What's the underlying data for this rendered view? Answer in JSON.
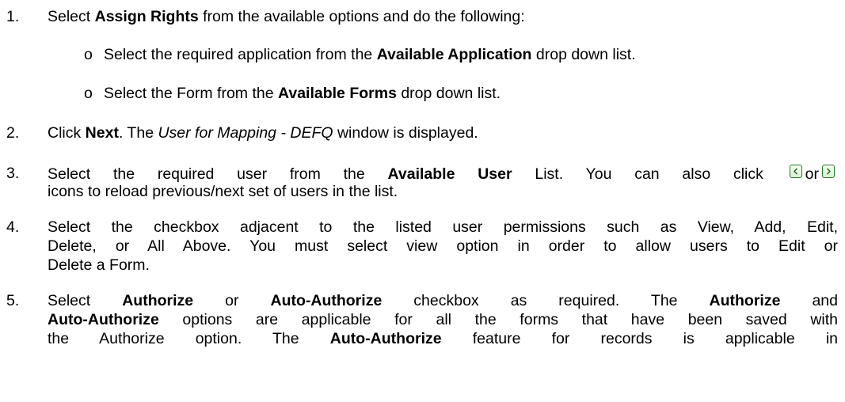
{
  "steps": [
    {
      "number": "1.",
      "pre": "Select ",
      "bold": "Assign Rights",
      "post": " from the available options and do the following:",
      "substeps": [
        {
          "bullet": "o",
          "pre": "Select the required application from the ",
          "bold": "Available Application",
          "post": " drop down list."
        },
        {
          "bullet": "o",
          "pre": "Select the Form from the ",
          "bold": "Available Forms",
          "post": " drop down list."
        }
      ]
    },
    {
      "number": "2.",
      "t1": "Click ",
      "b1": "Next",
      "t2": ". The ",
      "i1": "User for Mapping - DEFQ",
      "t3": " window is displayed."
    },
    {
      "number": "3.",
      "t1": "Select the required user from the ",
      "b1": "Available User",
      "t2": " List. You can also click",
      "t3": "or",
      "line2": "icons to reload previous/next set of users in the list.",
      "icon_prev": "previous-page-icon",
      "icon_next": "next-page-icon"
    },
    {
      "number": "4.",
      "line1": "Select the checkbox adjacent to the listed user permissions such as View, Add, Edit,",
      "line2": "Delete, or All Above. You must select view option in order to allow users to Edit or",
      "line3": "Delete a Form."
    },
    {
      "number": "5.",
      "l1_t1": "Select ",
      "l1_b1": "Authorize",
      "l1_t2": " or ",
      "l1_b2": "Auto-Authorize",
      "l1_t3": " checkbox as required. The ",
      "l1_b3": "Authorize",
      "l1_t4": " and",
      "l2_b1": "Auto-Authorize",
      "l2_t1": " options are applicable for all the forms that have been saved with",
      "l3_t1": "the Authorize option. The ",
      "l3_b1": "Auto-Authorize",
      "l3_t2": " feature for records is applicable in"
    }
  ],
  "colors": {
    "text": "#000000",
    "icon_border": "#2a7a2a"
  }
}
